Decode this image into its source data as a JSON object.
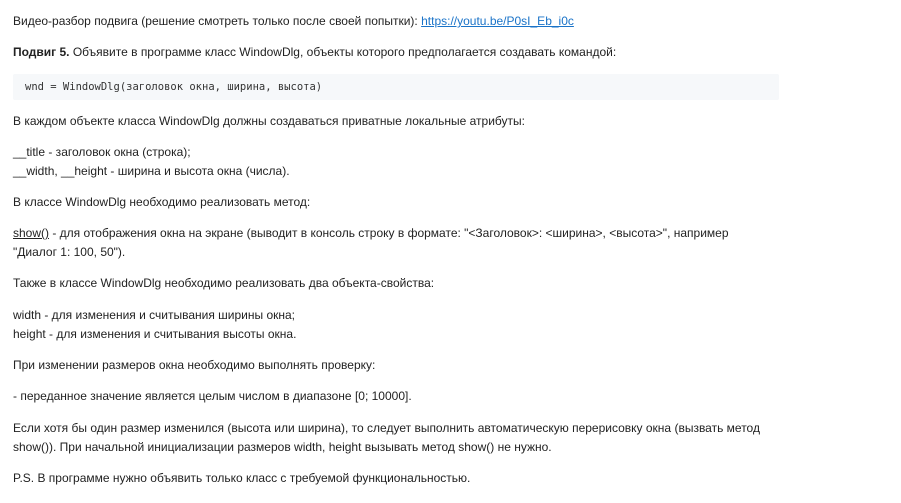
{
  "video": {
    "label": "Видео-разбор подвига (решение смотреть только после своей попытки): ",
    "link": "https://youtu.be/P0sI_Eb_i0c"
  },
  "task": {
    "title": "Подвиг 5.",
    "intro": " Объявите в программе класс WindowDlg, объекты которого предполагается создавать командой:"
  },
  "code": "wnd = WindowDlg(заголовок окна, ширина, высота)",
  "paragraphs": {
    "attrs_intro": "В каждом объекте класса WindowDlg должны создаваться приватные локальные атрибуты:",
    "attr_title": "__title - заголовок окна (строка);",
    "attr_size": "__width, __height - ширина и высота окна (числа).",
    "method_intro": "В классе WindowDlg необходимо реализовать метод:",
    "show_name": "show()",
    "show_desc": " - для отображения окна на экране (выводит в консоль строку в формате: \"<Заголовок>: <ширина>, <высота>\", например",
    "show_example": "\"Диалог 1: 100, 50\").",
    "props_intro": "Также в классе WindowDlg необходимо реализовать два объекта-свойства:",
    "prop_width": "width - для изменения и считывания ширины окна;",
    "prop_height": "height - для изменения и считывания высоты окна.",
    "check_intro": "При изменении размеров окна необходимо выполнять проверку:",
    "check_rule": "- переданное значение является целым числом в диапазоне [0; 10000].",
    "redraw_1": "Если хотя бы один размер изменился (высота или ширина), то следует выполнить автоматическую перерисовку окна (вызвать метод",
    "redraw_2": "show()). При начальной инициализации размеров width, height вызывать метод show() не нужно.",
    "ps": "P.S. В программе нужно объявить только класс с требуемой функциональностью."
  }
}
